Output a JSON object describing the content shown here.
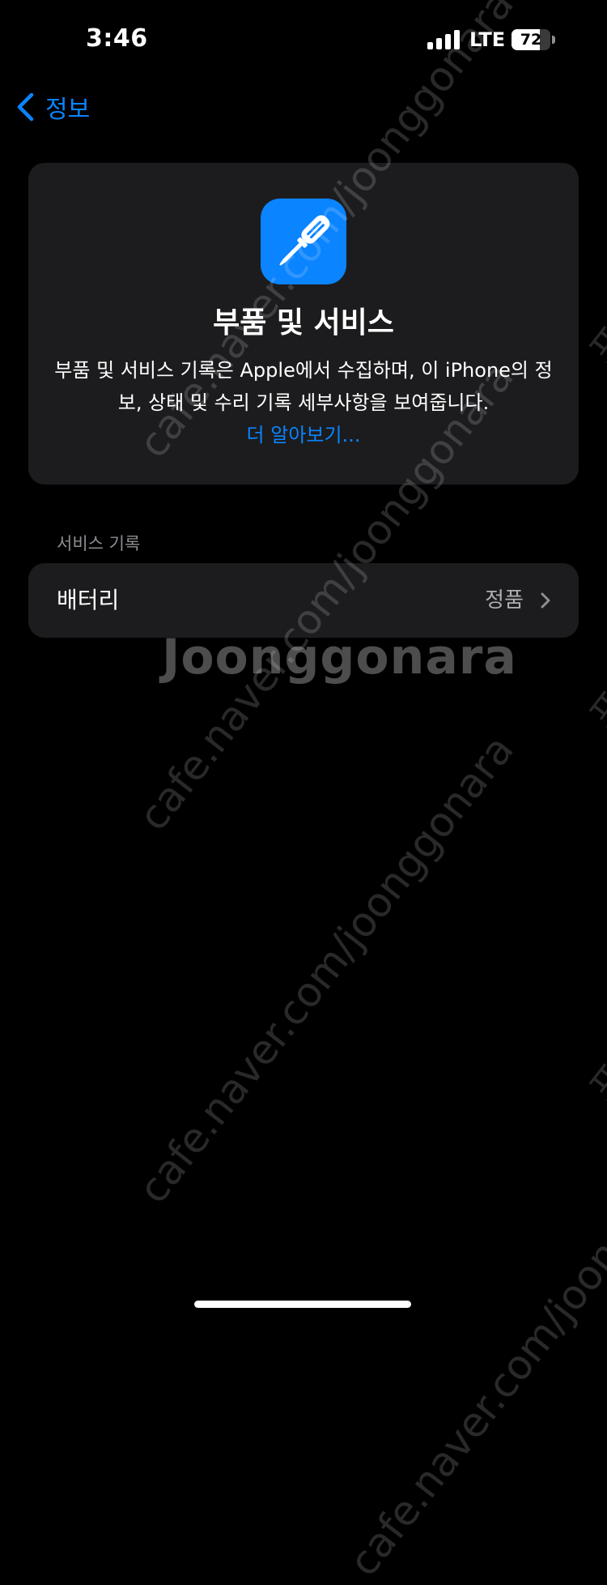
{
  "status_bar": {
    "time": "3:46",
    "network": "LTE",
    "battery_level": 72,
    "battery_text": "72",
    "signal_bars": 4
  },
  "nav": {
    "back_label": "정보",
    "accent_color": "#0a84ff"
  },
  "info_card": {
    "icon": "screwdriver-icon",
    "title": "부품 및 서비스",
    "description": "부품 및 서비스 기록은 Apple에서 수집하며, 이 iPhone의 정보, 상태 및 수리 기록 세부사항을 보여줍니다.",
    "learn_more": "더 알아보기..."
  },
  "service_history": {
    "header": "서비스 기록",
    "rows": [
      {
        "label": "배터리",
        "value": "정품"
      }
    ]
  },
  "watermark": {
    "url": "cafe.naver.com/joonggonara",
    "logo": "Joonggonara",
    "side_text": "포도"
  }
}
